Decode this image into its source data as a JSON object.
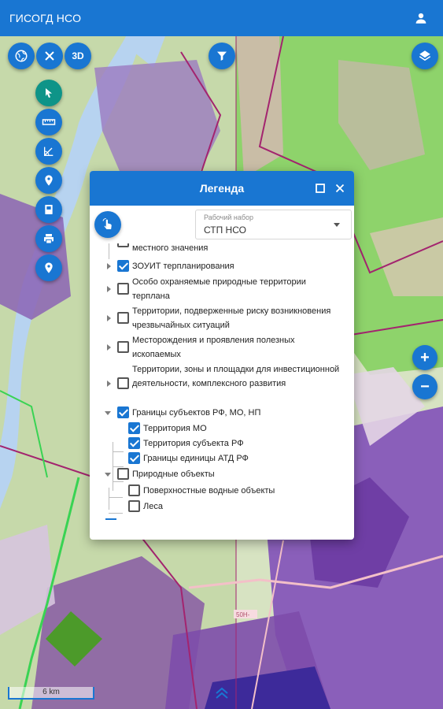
{
  "app": {
    "title": "ГИСОГД НСО",
    "account_icon": "account-icon"
  },
  "map": {
    "road_label": "50Н-",
    "scale_label": "6 km"
  },
  "toolbar_top": {
    "globe_icon": "globe-icon",
    "close_icon": "close-icon",
    "three_d_label": "3D",
    "filter_icon": "filter-icon",
    "layers_icon": "layers-icon"
  },
  "tools_left": [
    "select-cursor-icon",
    "ruler-icon",
    "angle-measure-icon",
    "location-pin-icon",
    "bookmark-icon",
    "print-icon",
    "place-marker-icon"
  ],
  "zoom": {
    "in_label": "+",
    "out_label": "−"
  },
  "legend": {
    "title": "Легенда",
    "working_set": {
      "label": "Рабочий набор",
      "value": "СТП НСО"
    },
    "items": [
      {
        "text": "местного значения",
        "checked": false,
        "level": 0
      },
      {
        "text": "ЗОУИТ терпланирования",
        "checked": true,
        "level": 0
      },
      {
        "text": "Особо охраняемые природные территории терплана",
        "checked": false,
        "level": 0
      },
      {
        "text": "Территории, подверженные риску возникновения чрезвычайных ситуаций",
        "checked": false,
        "level": 0
      },
      {
        "text": "Месторождения и проявления полезных ископаемых",
        "checked": false,
        "level": 0
      },
      {
        "text": "Территории, зоны и площадки для инвестиционной деятельности, комплексного развития",
        "checked": false,
        "level": 0
      },
      {
        "text": "Границы субъектов РФ, МО, НП",
        "checked": true,
        "level": 0
      },
      {
        "text": "Территория МО",
        "checked": true,
        "level": 1
      },
      {
        "text": "Территория субъекта РФ",
        "checked": true,
        "level": 1
      },
      {
        "text": "Границы единицы АТД РФ",
        "checked": true,
        "level": 1
      },
      {
        "text": "Природные объекты",
        "checked": false,
        "level": 0
      },
      {
        "text": "Поверхностные водные объекты",
        "checked": false,
        "level": 1
      },
      {
        "text": "Леса",
        "checked": false,
        "level": 1
      }
    ]
  },
  "colors": {
    "primary": "#1976d2",
    "teal": "#0e9488",
    "forest": "#8ed36b",
    "admin_purple": "#7a3fa2",
    "water": "#b7d3f0"
  }
}
